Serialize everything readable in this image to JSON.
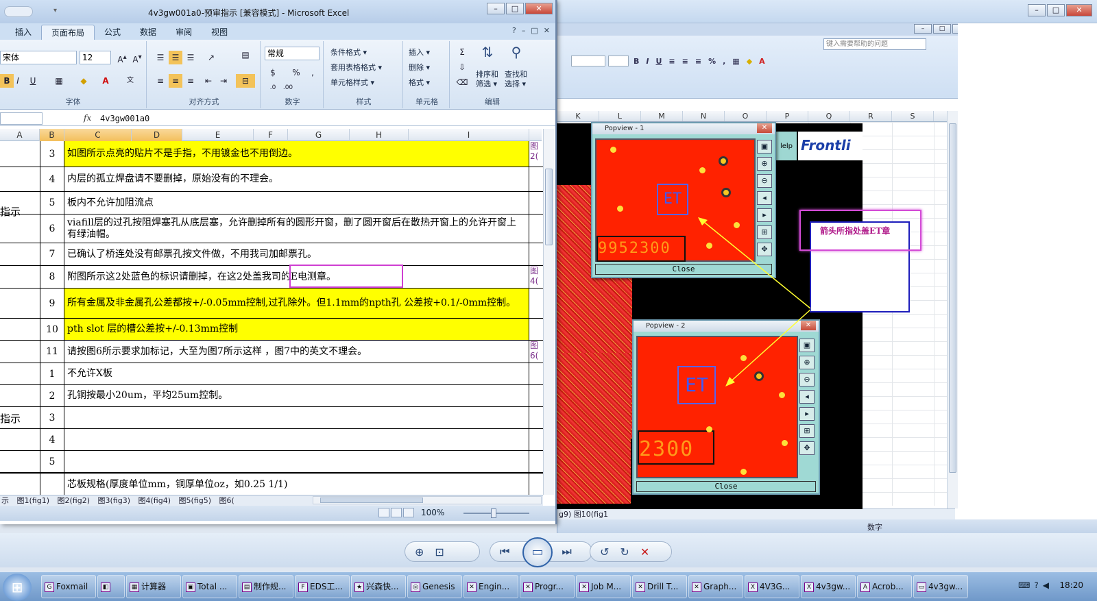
{
  "main_window": {
    "title": "4v3gw001a0-预审指示 [兼容模式] - Microsoft Excel",
    "tabs": [
      "插入",
      "页面布局",
      "公式",
      "数据",
      "审阅",
      "视图"
    ],
    "active_tab": "页面布局",
    "ribbon": {
      "font_name": "宋体",
      "font_size": "12",
      "number_format": "常规",
      "group_labels": {
        "font": "字体",
        "align": "对齐方式",
        "number": "数字",
        "style": "样式",
        "cells": "单元格",
        "edit": "编辑"
      },
      "style_buttons": [
        "条件格式 ▾",
        "套用表格格式 ▾",
        "单元格样式 ▾"
      ],
      "cell_buttons": [
        "插入 ▾",
        "删除 ▾",
        "格式 ▾"
      ],
      "sort_label": "排序和\n筛选 ▾",
      "find_label": "查找和\n选择 ▾"
    },
    "formula_bar": {
      "name_box": "",
      "fx": "fx",
      "content": "4v3gw001a0"
    },
    "columns": [
      "A",
      "B",
      "C",
      "D",
      "E",
      "F",
      "G",
      "H",
      "I"
    ],
    "rows": [
      {
        "num": "3",
        "text": "如图所示点亮的贴片不是手指，不用镀金也不用倒边。",
        "ref": "图2(",
        "yellow": true
      },
      {
        "num": "4",
        "text": "内层的孤立焊盘请不要删掉，原始没有的不理会。",
        "ref": "",
        "yellow": false
      },
      {
        "num": "5",
        "text": "板内不允许加阻流点",
        "ref": "",
        "yellow": false
      },
      {
        "num": "6",
        "text": "viafill层的过孔按阻焊塞孔从底层塞，允许删掉所有的圆形开窗，删了圆开窗后在散热开窗上的允许开窗上有绿油帽。",
        "ref": "",
        "yellow": false
      },
      {
        "num": "7",
        "text": "已确认了桥连处没有邮票孔按文件做，不用我司加邮票孔。",
        "ref": "",
        "yellow": false
      },
      {
        "num": "8",
        "text": "附图所示这2处蓝色的标识请删掉，在这2处盖我司的E电测章。",
        "ref": "图4(",
        "yellow": false
      },
      {
        "num": "9",
        "text": "所有金属及非金属孔公差都按+/-0.05mm控制,过孔除外。但1.1mm的npth孔 公差按+0.1/-0mm控制。",
        "ref": "",
        "yellow": true
      },
      {
        "num": "10",
        "text": "pth slot 层的槽公差按+/-0.13mm控制",
        "ref": "",
        "yellow": true
      },
      {
        "num": "11",
        "text": "请按图6所示要求加标记，大至为图7所示这样 ，图7中的英文不理会。",
        "ref": "图6(",
        "yellow": false
      },
      {
        "num": "1",
        "text": "不允许X板",
        "ref": "",
        "yellow": false
      },
      {
        "num": "2",
        "text": "孔铜按最小20um，平均25um控制。",
        "ref": "",
        "yellow": false
      },
      {
        "num": "3",
        "text": "",
        "ref": "",
        "yellow": false
      },
      {
        "num": "4",
        "text": "",
        "ref": "",
        "yellow": false
      },
      {
        "num": "5",
        "text": "",
        "ref": "",
        "yellow": false
      },
      {
        "num": "",
        "text": "芯板规格(厚度单位mm，铜厚单位oz，如0.25 1/1)",
        "ref": "",
        "yellow": false
      }
    ],
    "section_labels": [
      "指示",
      "指示"
    ],
    "sheet_tabs": [
      "示",
      "图1(fig1)",
      "图2(fig2)",
      "图3(fig3)",
      "图4(fig4)",
      "图5(fig5)",
      "图6("
    ],
    "zoom": "100%"
  },
  "bg_window": {
    "help_placeholder": "键入需要帮助的问题",
    "columns": [
      "K",
      "L",
      "M",
      "N",
      "O",
      "P",
      "Q",
      "R",
      "S"
    ],
    "sheet_tabs": "g9) 图10(fig1",
    "status_text": "数字",
    "help_label": "lelp",
    "logo_text": "Frontli"
  },
  "popups": [
    {
      "title": "Popview - 1",
      "et": "ET",
      "number": "9952300",
      "close": "Close"
    },
    {
      "title": "Popview - 2",
      "et": "ET",
      "number": "2300",
      "close": "Close"
    }
  ],
  "callout_text": "箭头所指处盖ET章",
  "taskbar": {
    "items": [
      "Foxmail",
      "",
      "计算器",
      "Total ...",
      "制作规...",
      "EDS工...",
      "兴森快...",
      "Genesis",
      "Engin...",
      "Progr...",
      "Job M...",
      "Drill T...",
      "Graph...",
      "4V3G...",
      "4v3gw...",
      "Acrob...",
      "4v3gw..."
    ],
    "clock": "18:20"
  }
}
